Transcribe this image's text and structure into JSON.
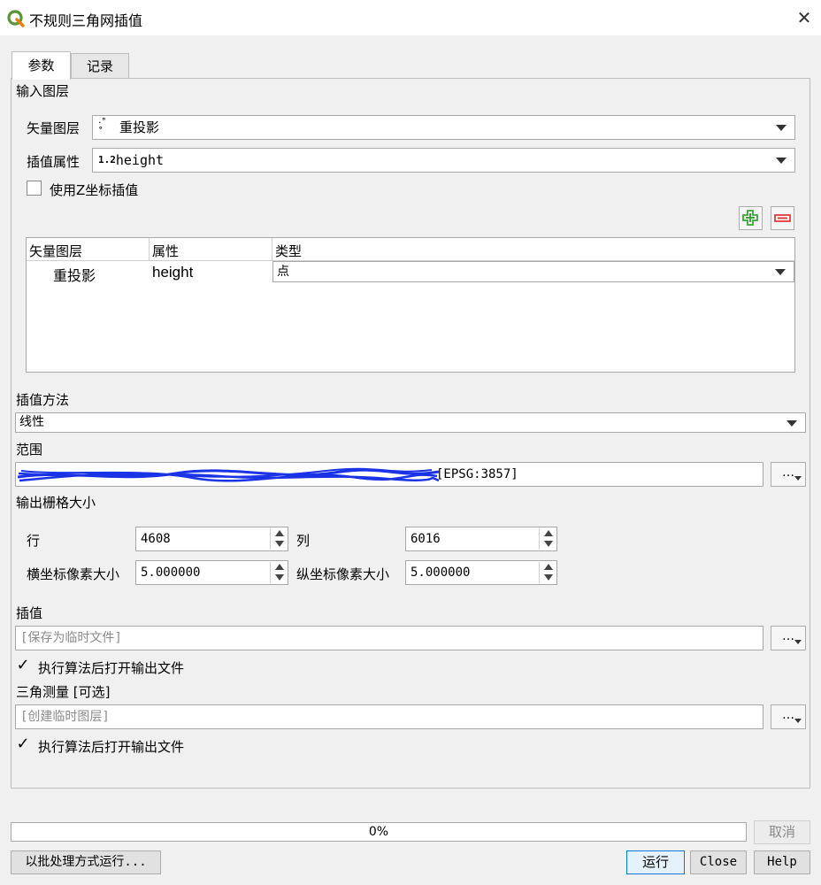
{
  "window": {
    "title": "不规则三角网插值"
  },
  "tabs": [
    {
      "label": "参数"
    },
    {
      "label": "记录"
    }
  ],
  "input_layers": {
    "section_label": "输入图层",
    "vector_layer_label": "矢量图层",
    "vector_layer_value": "重投影",
    "interp_attr_label": "插值属性",
    "interp_attr_type_badge": "1.2",
    "interp_attr_value": "height",
    "use_z_label": "使用Z坐标插值",
    "use_z_checked": false
  },
  "layer_table": {
    "columns": [
      "矢量图层",
      "属性",
      "类型"
    ],
    "rows": [
      {
        "layer": "重投影",
        "attribute": "height",
        "type": "点"
      }
    ]
  },
  "method": {
    "label": "插值方法",
    "value": "线性"
  },
  "extent": {
    "label": "范围",
    "value_suffix": "[EPSG:3857]"
  },
  "raster_size": {
    "label": "输出栅格大小",
    "rows_label": "行",
    "rows_value": "4608",
    "cols_label": "列",
    "cols_value": "6016",
    "pixel_x_label": "横坐标像素大小",
    "pixel_x_value": "5.000000",
    "pixel_y_label": "纵坐标像素大小",
    "pixel_y_value": "5.000000"
  },
  "interpolated": {
    "label": "插值",
    "placeholder": "[保存为临时文件]",
    "open_output_label": "执行算法后打开输出文件",
    "open_output_checked": true
  },
  "triangulation": {
    "label": "三角测量 [可选]",
    "placeholder": "[创建临时图层]",
    "open_output_label": "执行算法后打开输出文件",
    "open_output_checked": true
  },
  "ellipsis": "…",
  "footer": {
    "progress_text": "0%",
    "progress_value": 0,
    "cancel_label": "取消",
    "batch_label": "以批处理方式运行...",
    "run_label": "运行",
    "close_label": "Close",
    "help_label": "Help"
  },
  "colors": {
    "accent": "#0078d7",
    "add_icon": "#3aa33a",
    "remove_icon": "#e03c3c",
    "scribble": "#1a33e6"
  }
}
